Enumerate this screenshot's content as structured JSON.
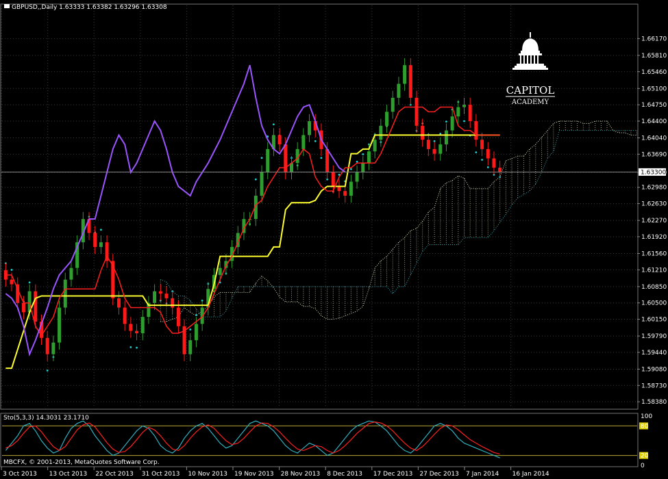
{
  "header": {
    "main_label": "GBPUSD,,Daily  1.63333 1.63382 1.63296 1.63308",
    "stoch_label": "Sto(5,3,3) 14.3031 23.1710",
    "copyright": "MBCFX, © 2001-2013, MetaQuotes Software Corp."
  },
  "logo": {
    "line1": "CAPITOL",
    "line2": "ACADEMY"
  },
  "current_price_tag": "1.63300",
  "colors": {
    "bull_candle": "#2e9e2e",
    "bear_candle": "#ff1a1a",
    "tenkan": "#ff2020",
    "kijun": "#ffff30",
    "chikou": "#9b55ff",
    "psar": "#20d0d0",
    "cloud_up": "#e8e8c8",
    "cloud_down": "#38a8b0",
    "stoch_main": "#30b0c0",
    "stoch_signal": "#ff2020",
    "level": "#b8a838"
  },
  "chart_data": [
    {
      "type": "candlestick",
      "symbol": "GBPUSD",
      "timeframe": "Daily",
      "ohlc_last": {
        "open": 1.63333,
        "high": 1.63382,
        "low": 1.63296,
        "close": 1.63308
      },
      "ylim": [
        1.5825,
        1.6688
      ],
      "y_ticks": [
        "1.66170",
        "1.65810",
        "1.65460",
        "1.65100",
        "1.64750",
        "1.64400",
        "1.64040",
        "1.63690",
        "1.63300",
        "1.62980",
        "1.62630",
        "1.62270",
        "1.61920",
        "1.61560",
        "1.61210",
        "1.60850",
        "1.60500",
        "1.60150",
        "1.59790",
        "1.59440",
        "1.59080",
        "1.58730",
        "1.58380"
      ],
      "x_ticks": [
        "3 Oct 2013",
        "13 Oct 2013",
        "22 Oct 2013",
        "31 Oct 2013",
        "10 Nov 2013",
        "19 Nov 2013",
        "28 Nov 2013",
        "8 Dec 2013",
        "17 Dec 2013",
        "27 Dec 2013",
        "7 Jan 2014",
        "16 Jan 2014"
      ],
      "close": [
        1.61,
        1.609,
        1.605,
        1.603,
        1.6075,
        1.601,
        1.5975,
        1.594,
        1.5965,
        1.604,
        1.61,
        1.6125,
        1.618,
        1.623,
        1.62,
        1.617,
        1.618,
        1.614,
        1.606,
        1.604,
        1.6005,
        1.599,
        1.5985,
        1.602,
        1.605,
        1.6075,
        1.607,
        1.606,
        1.604,
        1.6,
        1.594,
        1.597,
        1.6005,
        1.604,
        1.608,
        1.611,
        1.6125,
        1.614,
        1.617,
        1.62,
        1.623,
        1.623,
        1.628,
        1.633,
        1.638,
        1.641,
        1.639,
        1.633,
        1.635,
        1.638,
        1.641,
        1.644,
        1.642,
        1.638,
        1.633,
        1.63,
        1.629,
        1.628,
        1.631,
        1.633,
        1.635,
        1.6375,
        1.64,
        1.643,
        1.646,
        1.649,
        1.652,
        1.656,
        1.649,
        1.643,
        1.64,
        1.638,
        1.637,
        1.639,
        1.642,
        1.645,
        1.647,
        1.6475,
        1.644,
        1.64,
        1.638,
        1.636,
        1.634,
        1.6331
      ],
      "tenkan_sen": [
        1.611,
        1.611,
        1.608,
        1.605,
        1.605,
        1.6,
        1.598,
        1.6,
        1.602,
        1.606,
        1.608,
        1.608,
        1.608,
        1.608,
        1.608,
        1.608,
        1.612,
        1.615,
        1.613,
        1.61,
        1.606,
        1.604,
        1.604,
        1.604,
        1.604,
        1.604,
        1.603,
        1.6,
        1.5985,
        1.5985,
        1.599,
        1.6,
        1.601,
        1.602,
        1.604,
        1.607,
        1.61,
        1.613,
        1.615,
        1.618,
        1.621,
        1.623,
        1.626,
        1.627,
        1.63,
        1.632,
        1.634,
        1.634,
        1.635,
        1.636,
        1.638,
        1.637,
        1.632,
        1.63,
        1.629,
        1.629,
        1.632,
        1.634,
        1.634,
        1.635,
        1.635,
        1.635,
        1.635,
        1.637,
        1.64,
        1.643,
        1.646,
        1.647,
        1.647,
        1.647,
        1.647,
        1.646,
        1.646,
        1.647,
        1.647,
        1.647,
        1.643,
        1.642,
        1.642,
        1.641,
        1.641,
        1.641,
        1.641,
        1.641
      ],
      "kijun_sen": [
        1.591,
        1.591,
        1.595,
        1.599,
        1.603,
        1.606,
        1.6065,
        1.6065,
        1.6065,
        1.6065,
        1.6065,
        1.6065,
        1.6065,
        1.6065,
        1.6065,
        1.6065,
        1.6065,
        1.6065,
        1.6065,
        1.6065,
        1.6065,
        1.6065,
        1.6065,
        1.6065,
        1.6045,
        1.6045,
        1.6045,
        1.6045,
        1.6045,
        1.6045,
        1.6045,
        1.6045,
        1.6045,
        1.6045,
        1.6045,
        1.609,
        1.615,
        1.615,
        1.615,
        1.615,
        1.615,
        1.615,
        1.615,
        1.615,
        1.615,
        1.617,
        1.617,
        1.625,
        1.6265,
        1.6265,
        1.6265,
        1.6265,
        1.627,
        1.629,
        1.63,
        1.63,
        1.63,
        1.63,
        1.637,
        1.637,
        1.638,
        1.638,
        1.641,
        1.641,
        1.641,
        1.641,
        1.641,
        1.641,
        1.641,
        1.641,
        1.641,
        1.641,
        1.641,
        1.641,
        1.641,
        1.641,
        1.641,
        1.641,
        1.641,
        1.641,
        1.641,
        1.641,
        1.641,
        1.641
      ],
      "stochastic": {
        "levels": [
          80,
          20
        ],
        "range": [
          0,
          100
        ],
        "tick_labels": [
          "100",
          "80",
          "20",
          "0"
        ],
        "main": [
          30,
          45,
          60,
          80,
          85,
          70,
          50,
          35,
          25,
          30,
          55,
          75,
          85,
          90,
          80,
          60,
          45,
          30,
          20,
          25,
          40,
          55,
          70,
          80,
          75,
          60,
          40,
          30,
          25,
          35,
          55,
          70,
          80,
          85,
          75,
          60,
          45,
          35,
          40,
          55,
          70,
          85,
          90,
          85,
          80,
          70,
          55,
          40,
          30,
          25,
          35,
          45,
          40,
          30,
          20,
          25,
          40,
          55,
          70,
          80,
          85,
          90,
          88,
          80,
          70,
          55,
          40,
          30,
          25,
          35,
          50,
          65,
          80,
          85,
          80,
          70,
          55,
          45,
          40,
          35,
          30,
          25,
          20,
          15
        ],
        "signal": [
          35,
          40,
          50,
          65,
          78,
          80,
          68,
          52,
          38,
          30,
          38,
          55,
          72,
          82,
          86,
          78,
          62,
          46,
          33,
          26,
          28,
          38,
          52,
          67,
          77,
          72,
          60,
          45,
          33,
          30,
          40,
          55,
          68,
          78,
          82,
          75,
          62,
          50,
          42,
          45,
          55,
          68,
          80,
          86,
          85,
          78,
          68,
          55,
          43,
          33,
          30,
          35,
          40,
          38,
          30,
          25,
          30,
          40,
          52,
          65,
          75,
          85,
          88,
          86,
          80,
          70,
          57,
          45,
          35,
          30,
          38,
          50,
          63,
          75,
          82,
          80,
          72,
          62,
          52,
          45,
          38,
          32,
          26,
          23
        ]
      }
    }
  ]
}
